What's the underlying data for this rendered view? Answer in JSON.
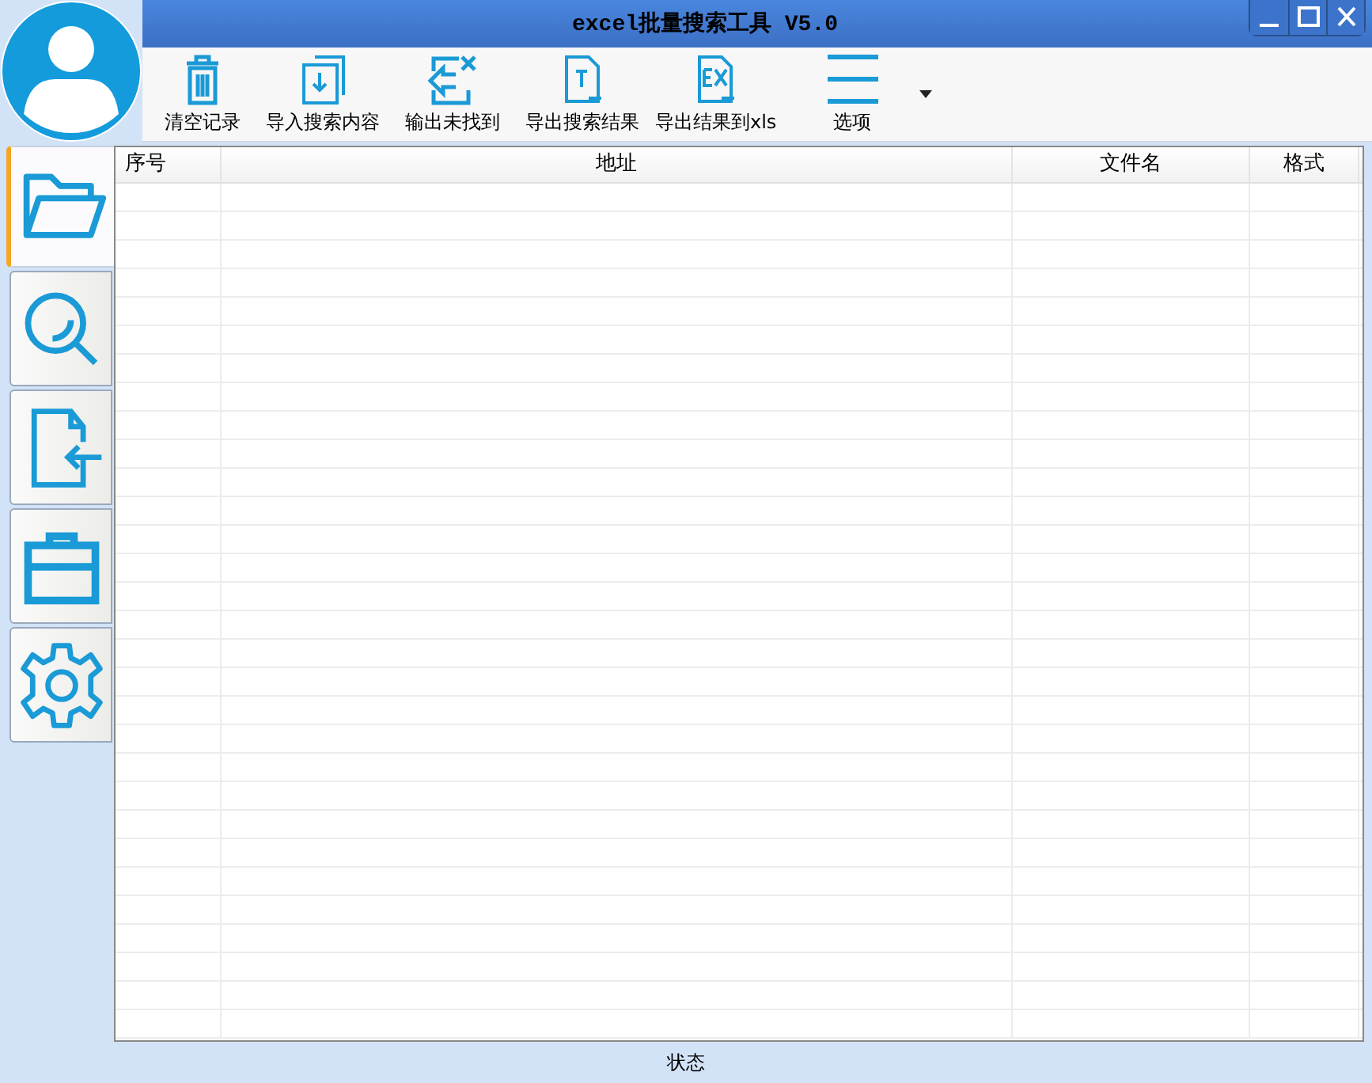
{
  "window": {
    "title": "excel批量搜索工具 V5.0"
  },
  "toolbar": [
    {
      "kind": "trash",
      "label": "清空记录"
    },
    {
      "kind": "import",
      "label": "导入搜索内容"
    },
    {
      "kind": "export-missing",
      "label": "输出未找到"
    },
    {
      "kind": "export-text",
      "label": "导出搜索结果"
    },
    {
      "kind": "export-excel",
      "label": "导出结果到xls"
    },
    {
      "kind": "menu",
      "label": "选项"
    }
  ],
  "sidebar": {
    "tabs": [
      {
        "kind": "folder",
        "selected": true
      },
      {
        "kind": "search",
        "selected": false
      },
      {
        "kind": "file-import",
        "selected": false
      },
      {
        "kind": "briefcase",
        "selected": false
      },
      {
        "kind": "settings",
        "selected": false
      }
    ]
  },
  "table": {
    "columns": [
      "序号",
      "地址",
      "文件名",
      "格式"
    ]
  },
  "status_bar": "状态"
}
